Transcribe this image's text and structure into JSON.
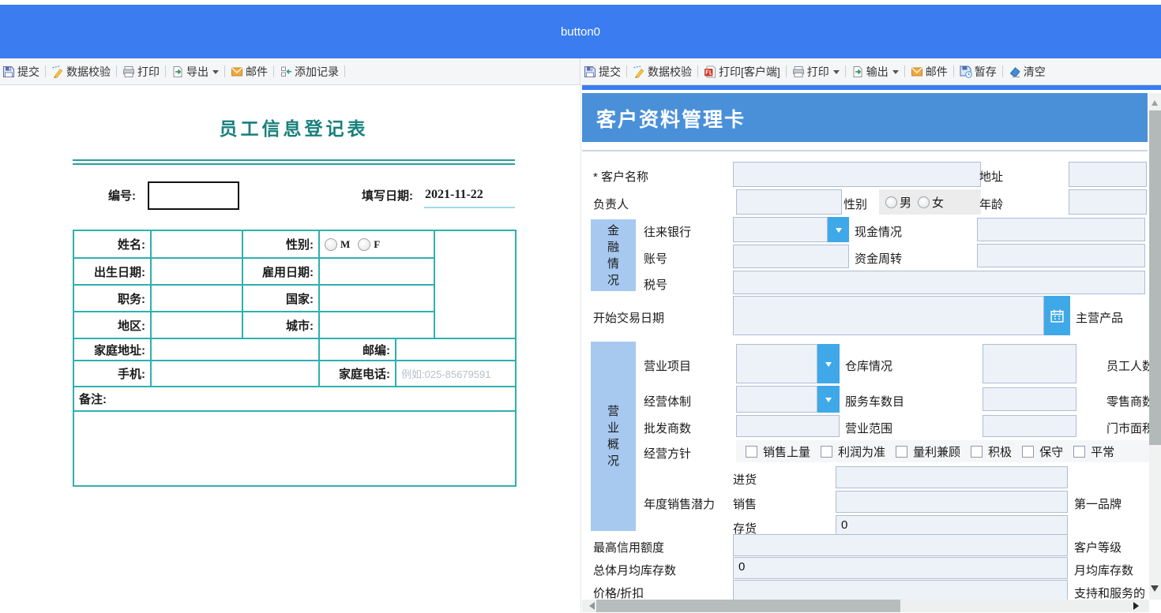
{
  "topbar": {
    "title": "button0"
  },
  "toolbar_left": {
    "items": [
      {
        "label": "提交"
      },
      {
        "label": "数据校验"
      },
      {
        "label": "打印"
      },
      {
        "label": "导出"
      },
      {
        "label": "邮件"
      },
      {
        "label": "添加记录"
      }
    ]
  },
  "toolbar_right": {
    "items": [
      {
        "label": "提交"
      },
      {
        "label": "数据校验"
      },
      {
        "label": "打印[客户端]"
      },
      {
        "label": "打印"
      },
      {
        "label": "输出"
      },
      {
        "label": "邮件"
      },
      {
        "label": "暂存"
      },
      {
        "label": "清空"
      }
    ]
  },
  "employee_form": {
    "title": "员工信息登记表",
    "id_label": "编号:",
    "date_label": "填写日期:",
    "date_value": "2021-11-22",
    "name_label": "姓名:",
    "gender_label": "性别:",
    "gender_m": "M",
    "gender_f": "F",
    "birth_label": "出生日期:",
    "hire_label": "雇用日期:",
    "position_label": "职务:",
    "country_label": "国家:",
    "region_label": "地区:",
    "city_label": "城市:",
    "home_address_label": "家庭地址:",
    "zip_label": "邮编:",
    "mobile_label": "手机:",
    "home_phone_label": "家庭电话:",
    "home_phone_placeholder": "例如:025-85679591",
    "notes_label": "备注:"
  },
  "customer_form": {
    "title": "客户资料管理卡",
    "customer_name_label": "* 客户名称",
    "address_label": "地址",
    "manager_label": "负责人",
    "gender_label": "性别",
    "gender_male": "男",
    "gender_female": "女",
    "age_label": "年龄",
    "finance_section_label": "金融情况",
    "bank_label": "往来银行",
    "cash_label": "现金情况",
    "account_label": "账号",
    "capital_label": "资金周转",
    "tax_label": "税号",
    "trade_date_label": "开始交易日期",
    "main_products_label": "主营产品",
    "business_section_label": "营业概况",
    "business_items_label": "营业项目",
    "warehouse_label": "仓库情况",
    "staff_label": "员工人数及素",
    "system_label": "经营体制",
    "vehicles_label": "服务车数目",
    "retailers_label": "零售商数及覆",
    "wholesalers_label": "批发商数",
    "scope_label": "营业范围",
    "store_area_label": "门市面积",
    "policy_label": "经营方针",
    "policy_options": [
      "销售上量",
      "利润为准",
      "量利兼顾",
      "积极",
      "保守",
      "平常"
    ],
    "potential_label": "年度销售潜力",
    "purchase_label": "进货",
    "sales_label": "销售",
    "stock_label": "存货",
    "stock_value": "0",
    "brand_label": "第一品牌",
    "credit_label": "最高信用额度",
    "grade_label": "客户等级",
    "monthly_total_label": "总体月均库存数",
    "monthly_total_value": "0",
    "monthly_label": "月均库存数",
    "price_label": "价格/折扣",
    "support_label": "支持和服务的"
  },
  "colors": {
    "topbar_blue": "#3b7cf0",
    "header_blue": "#4a90d9",
    "section_blue": "#a7c9f0",
    "combo_blue": "#3fa8e8",
    "table_teal": "#2fb0b0",
    "title_teal": "#17807d"
  }
}
